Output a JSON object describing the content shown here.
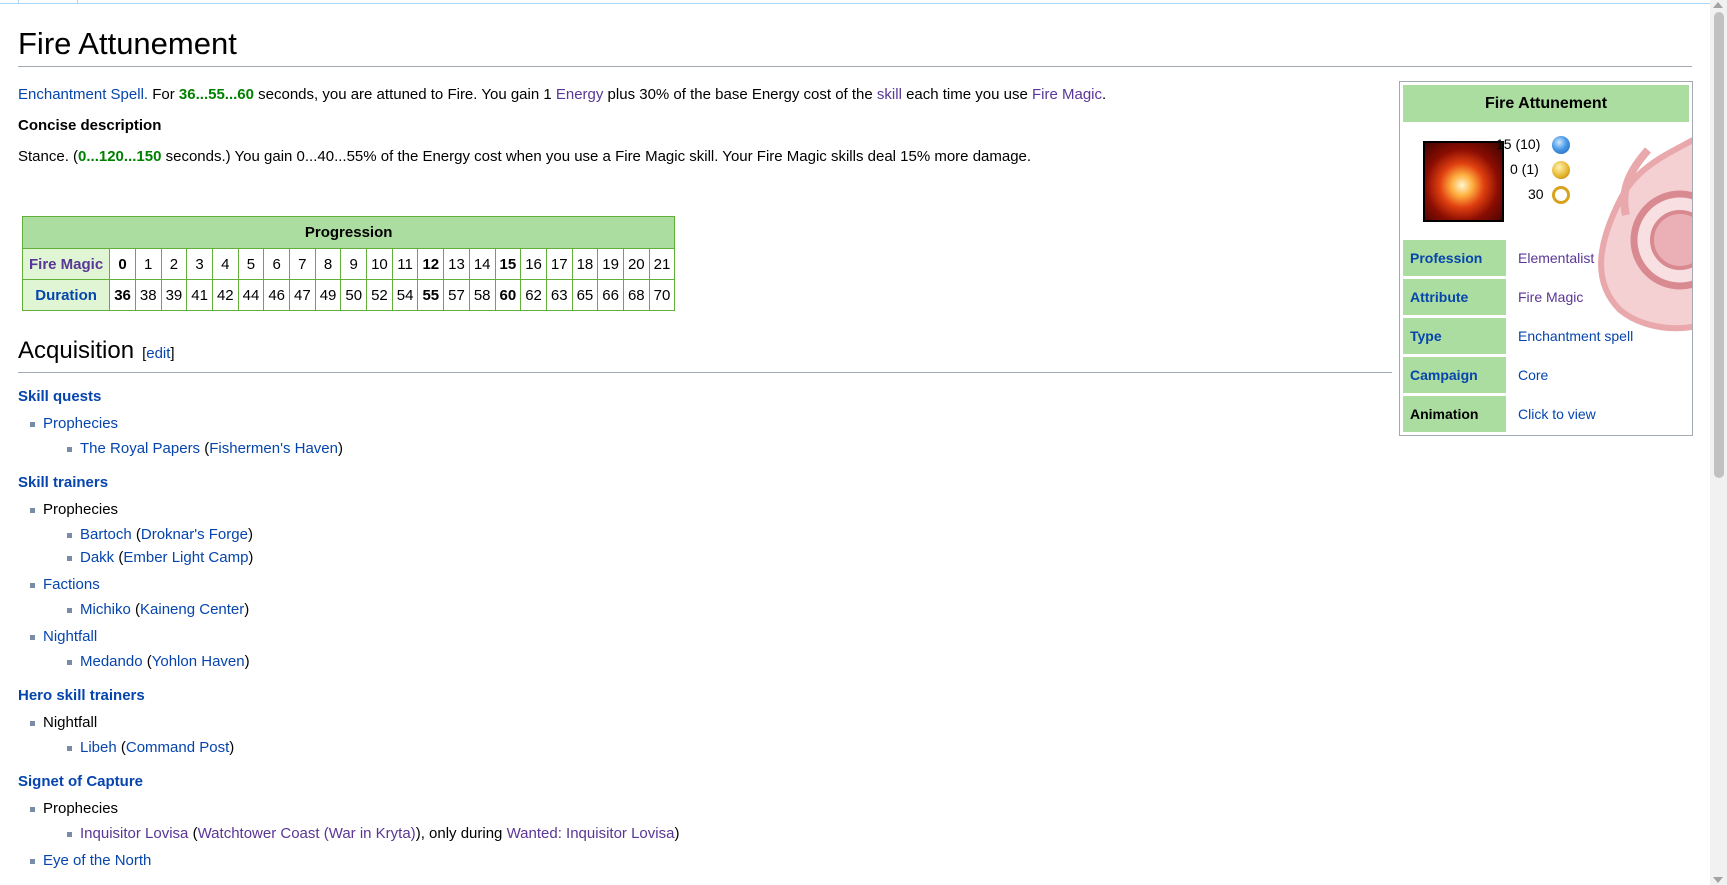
{
  "page": {
    "title": "Fire Attunement",
    "intro": {
      "enchantment_spell": "Enchantment Spell.",
      "for": " For ",
      "duration": "36...55...60",
      "after_duration": " seconds, you are attuned to Fire. You gain 1 ",
      "energy": "Energy",
      "after_energy": " plus 30% of the base Energy cost of the ",
      "skill": "skill",
      "after_skill": " each time you use ",
      "fire_magic": "Fire Magic",
      "end": "."
    },
    "concise_heading": "Concise description",
    "concise": {
      "start": "Stance. (",
      "duration": "0...120...150",
      "end": " seconds.) You gain 0...40...55% of the Energy cost when you use a Fire Magic skill. Your Fire Magic skills deal 15% more damage."
    }
  },
  "progression": {
    "title": "Progression",
    "row1_label": "Fire Magic",
    "row2_label": "Duration",
    "levels": [
      "0",
      "1",
      "2",
      "3",
      "4",
      "5",
      "6",
      "7",
      "8",
      "9",
      "10",
      "11",
      "12",
      "13",
      "14",
      "15",
      "16",
      "17",
      "18",
      "19",
      "20",
      "21"
    ],
    "durations": [
      "36",
      "38",
      "39",
      "41",
      "42",
      "44",
      "46",
      "47",
      "49",
      "50",
      "52",
      "54",
      "55",
      "57",
      "58",
      "60",
      "62",
      "63",
      "65",
      "66",
      "68",
      "70"
    ]
  },
  "acquisition": {
    "heading": "Acquisition",
    "edit_label": "edit",
    "skill_quests": {
      "heading": "Skill quests",
      "campaign": "Prophecies",
      "quest": "The Royal Papers",
      "location": "Fishermen's Haven"
    },
    "skill_trainers": {
      "heading": "Skill trainers",
      "prophecies": "Prophecies",
      "bartoch": "Bartoch",
      "droknar": "Droknar's Forge",
      "dakk": "Dakk",
      "ember": "Ember Light Camp",
      "factions": "Factions",
      "michiko": "Michiko",
      "kaineng": "Kaineng Center",
      "nightfall": "Nightfall",
      "medando": "Medando",
      "yohlon": "Yohlon Haven"
    },
    "hero_trainers": {
      "heading": "Hero skill trainers",
      "nightfall": "Nightfall",
      "libeh": "Libeh",
      "command_post": "Command Post"
    },
    "signet": {
      "heading": "Signet of Capture",
      "prophecies": "Prophecies",
      "boss": "Inquisitor Lovisa",
      "location": "Watchtower Coast (War in Kryta)",
      "only_during": ", only during ",
      "quest": "Wanted: Inquisitor Lovisa"
    },
    "cut_item": "Eye of the North"
  },
  "infobox": {
    "title": "Fire Attunement",
    "energy": "15 (10)",
    "activation": "0 (1)",
    "recharge": "30",
    "icons": [
      "energy-orb-icon",
      "activation-clock-icon",
      "recharge-icon"
    ],
    "rows": [
      {
        "label": "Profession",
        "value": "Elementalist"
      },
      {
        "label": "Attribute",
        "value": "Fire Magic"
      },
      {
        "label": "Type",
        "value": "Enchantment spell"
      },
      {
        "label": "Campaign",
        "value": "Core"
      },
      {
        "label": "Animation",
        "value": "Click to view"
      }
    ]
  },
  "colors": {
    "header_green": "#abdca0",
    "row_green": "#dff5d4",
    "border_green": "#62b03a",
    "link": "#0645ad",
    "visited": "#5a3696",
    "number_green": "#008000"
  }
}
